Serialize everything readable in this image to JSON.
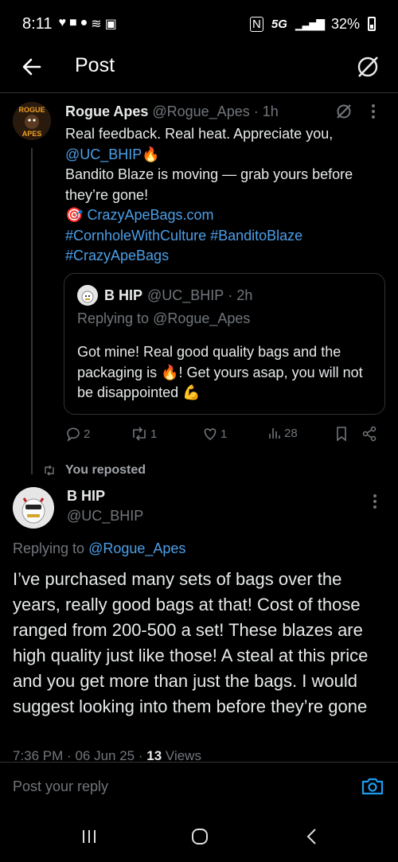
{
  "status_bar": {
    "time": "8:11",
    "network": "5G",
    "battery": "32%"
  },
  "header": {
    "title": "Post"
  },
  "tweet": {
    "display_name": "Rogue Apes",
    "handle": "@Rogue_Apes",
    "time": "1h",
    "line1": "Real feedback. Real heat. Appreciate you,",
    "mention": "@UC_BHIP",
    "line3": "Bandito Blaze is moving — grab yours before they’re gone!",
    "link": "CrazyApeBags.com",
    "hashtags_line1": "#CornholeWithCulture #BanditoBlaze",
    "hashtags_line2": "#CrazyApeBags",
    "avatar_text_top": "ROGUE",
    "avatar_text_bottom": "APES"
  },
  "quote": {
    "display_name": "B HIP",
    "handle": "@UC_BHIP",
    "time": "2h",
    "replying_to_prefix": "Replying to ",
    "replying_to": "@Rogue_Apes",
    "body_a": "Got mine! Real good quality bags and the packaging is ",
    "body_b": "! Get yours asap, you will not be disappointed "
  },
  "actions": {
    "replies": "2",
    "reposts": "1",
    "likes": "1",
    "views": "28"
  },
  "repost_note": {
    "label": "You reposted"
  },
  "main": {
    "display_name": "B HIP",
    "handle": "@UC_BHIP",
    "replying_to_prefix": "Replying to ",
    "replying_to": "@Rogue_Apes",
    "body": "I’ve purchased many sets of bags over the years, really good bags at that! Cost of those ranged from 200-500 a set! These blazes are high quality just like those! A steal at this price and you get more than just the bags. I would suggest looking into them before they’re gone",
    "time": "7:36 PM",
    "date": "06 Jun 25",
    "views_count": "13",
    "views_label": "Views"
  },
  "reply_bar": {
    "placeholder": "Post your reply"
  },
  "colors": {
    "background": "#000000",
    "link": "#4c9fe8",
    "muted": "#71767b",
    "text": "#e7e9ea",
    "divider": "#2f3336"
  }
}
